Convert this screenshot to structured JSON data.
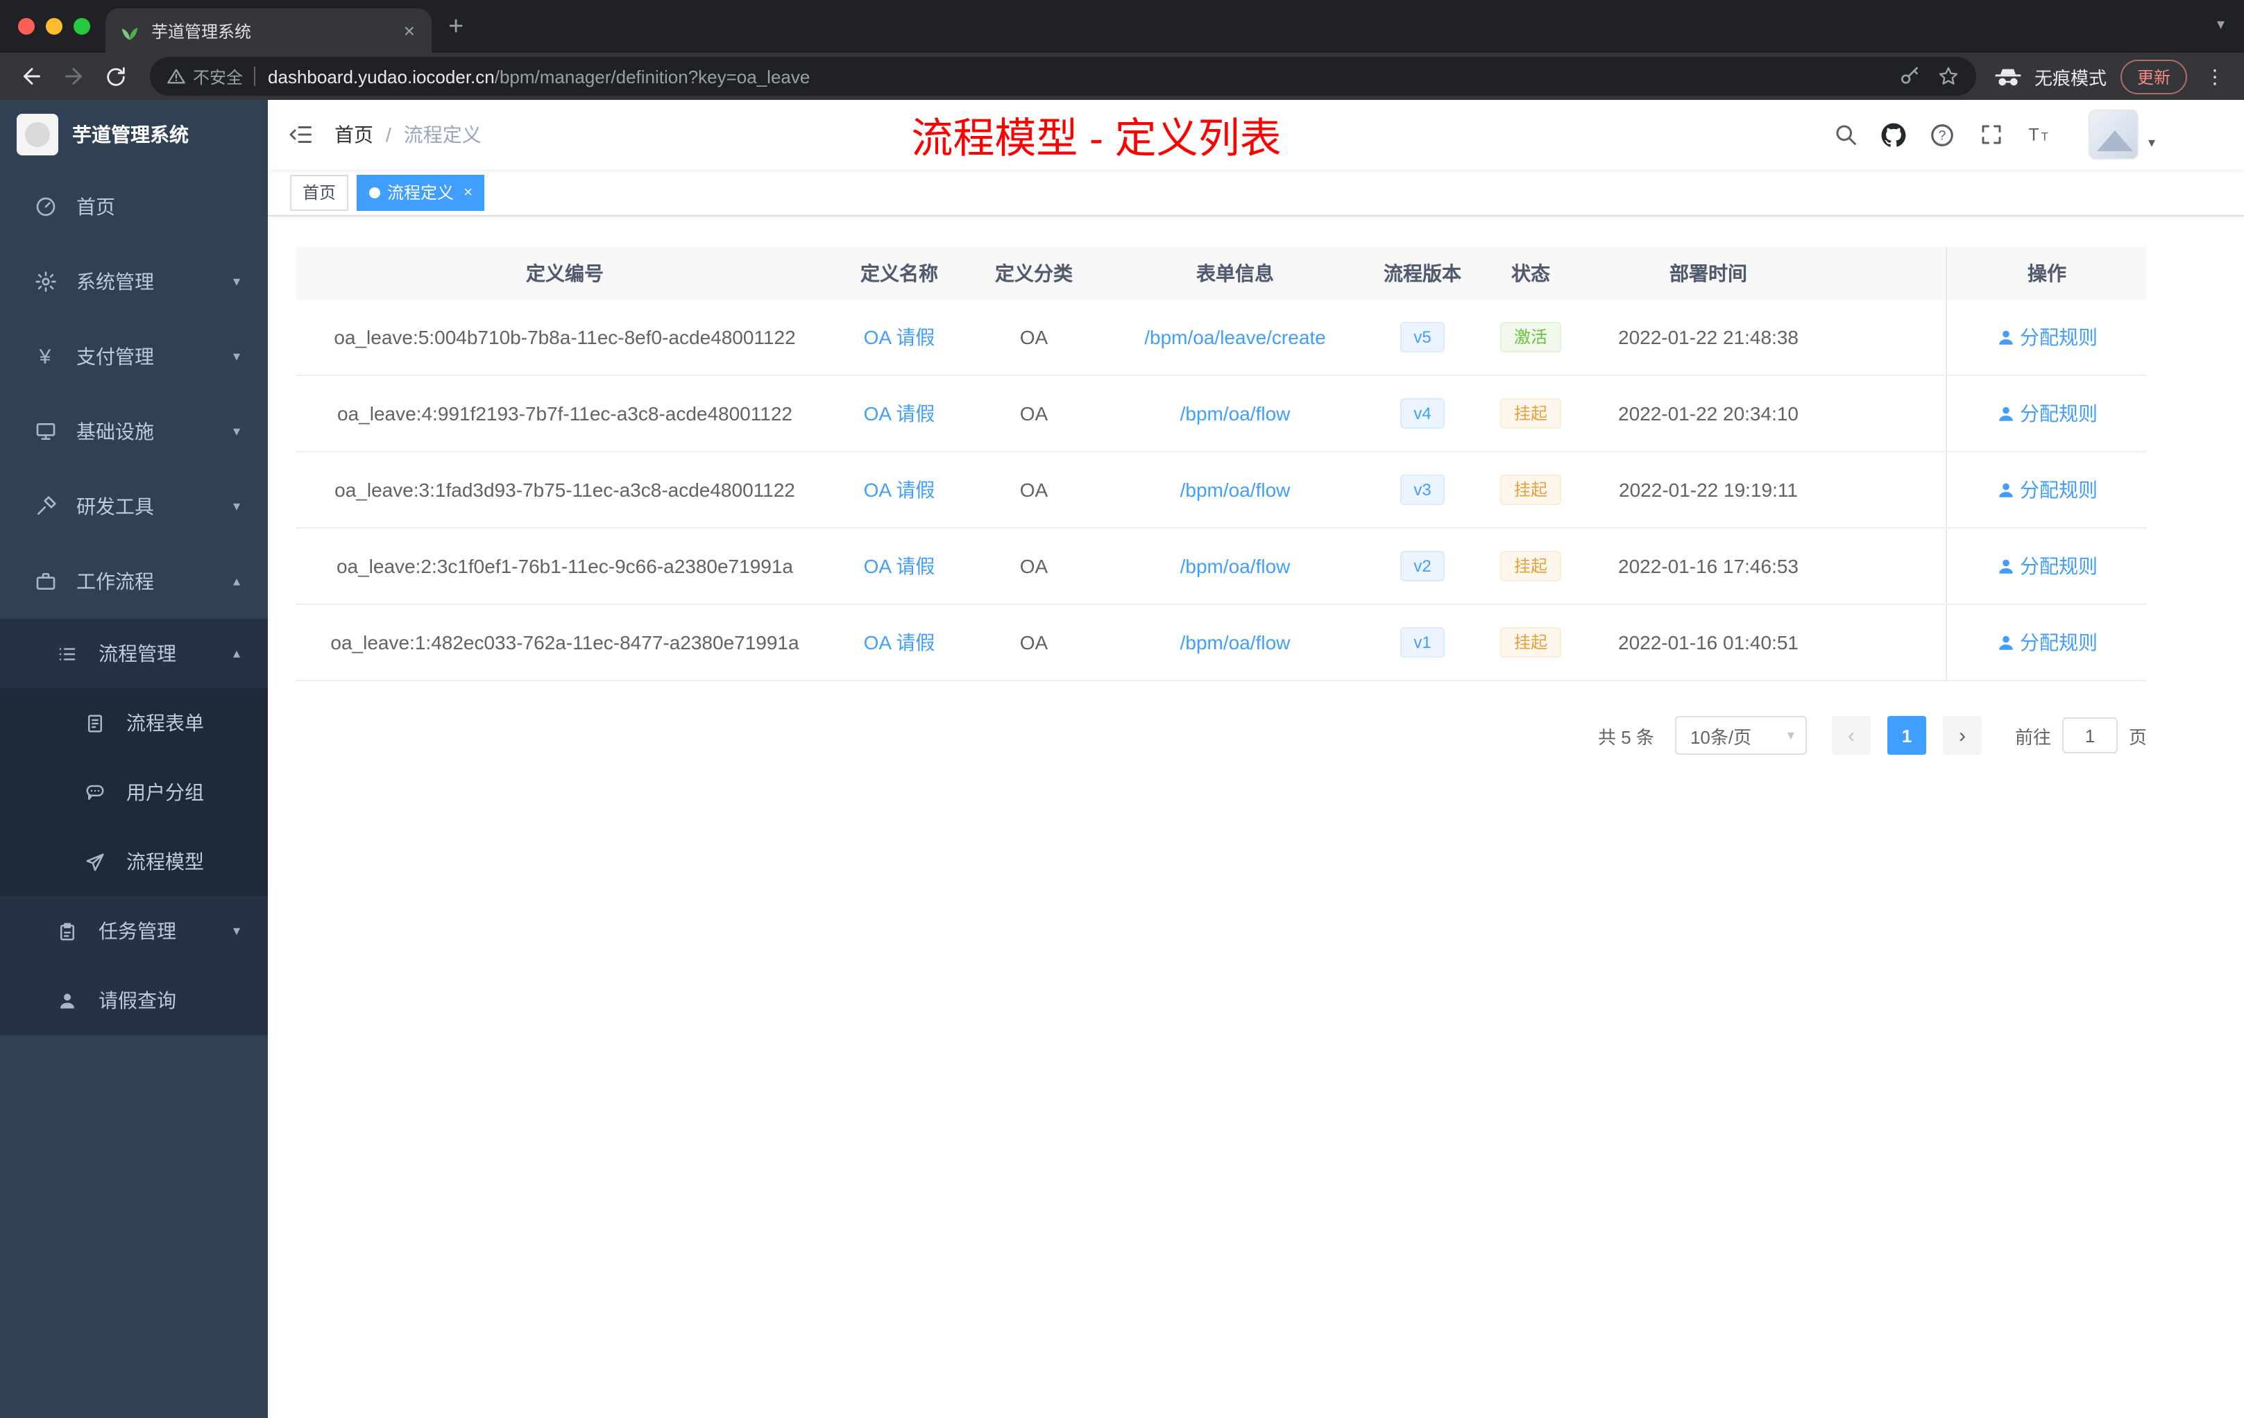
{
  "colors": {
    "accent": "#409eff",
    "success": "#67c23a",
    "warning": "#e6a23c",
    "annotation_red": "#ff0000",
    "sidebar_bg": "#304156"
  },
  "browser": {
    "tab_title": "芋道管理系统",
    "not_secure": "不安全",
    "url_host": "dashboard.yudao.iocoder.cn",
    "url_path": "/bpm/manager/definition?key=oa_leave",
    "incognito_label": "无痕模式",
    "update_label": "更新"
  },
  "sidebar": {
    "logo_title": "芋道管理系统",
    "items": [
      {
        "label": "首页"
      },
      {
        "label": "系统管理"
      },
      {
        "label": "支付管理"
      },
      {
        "label": "基础设施"
      },
      {
        "label": "研发工具"
      },
      {
        "label": "工作流程"
      },
      {
        "label": "流程管理"
      },
      {
        "label": "流程表单"
      },
      {
        "label": "用户分组"
      },
      {
        "label": "流程模型"
      },
      {
        "label": "任务管理"
      },
      {
        "label": "请假查询"
      }
    ]
  },
  "navbar": {
    "breadcrumb_home": "首页",
    "breadcrumb_separator": "/",
    "breadcrumb_current": "流程定义",
    "annotation": "流程模型 - 定义列表"
  },
  "tags": {
    "home": "首页",
    "active": "流程定义"
  },
  "table": {
    "columns": [
      "定义编号",
      "定义名称",
      "定义分类",
      "表单信息",
      "流程版本",
      "状态",
      "部署时间",
      "操作"
    ],
    "rows": [
      {
        "id": "oa_leave:5:004b710b-7b8a-11ec-8ef0-acde48001122",
        "name": "OA 请假",
        "category": "OA",
        "form": "/bpm/oa/leave/create",
        "version": "v5",
        "status": "激活",
        "status_class": "tag-success",
        "time": "2022-01-22 21:48:38",
        "action": "分配规则"
      },
      {
        "id": "oa_leave:4:991f2193-7b7f-11ec-a3c8-acde48001122",
        "name": "OA 请假",
        "category": "OA",
        "form": "/bpm/oa/flow",
        "version": "v4",
        "status": "挂起",
        "status_class": "tag-warning",
        "time": "2022-01-22 20:34:10",
        "action": "分配规则"
      },
      {
        "id": "oa_leave:3:1fad3d93-7b75-11ec-a3c8-acde48001122",
        "name": "OA 请假",
        "category": "OA",
        "form": "/bpm/oa/flow",
        "version": "v3",
        "status": "挂起",
        "status_class": "tag-warning",
        "time": "2022-01-22 19:19:11",
        "action": "分配规则"
      },
      {
        "id": "oa_leave:2:3c1f0ef1-76b1-11ec-9c66-a2380e71991a",
        "name": "OA 请假",
        "category": "OA",
        "form": "/bpm/oa/flow",
        "version": "v2",
        "status": "挂起",
        "status_class": "tag-warning",
        "time": "2022-01-16 17:46:53",
        "action": "分配规则"
      },
      {
        "id": "oa_leave:1:482ec033-762a-11ec-8477-a2380e71991a",
        "name": "OA 请假",
        "category": "OA",
        "form": "/bpm/oa/flow",
        "version": "v1",
        "status": "挂起",
        "status_class": "tag-warning",
        "time": "2022-01-16 01:40:51",
        "action": "分配规则"
      }
    ]
  },
  "pagination": {
    "total": "共 5 条",
    "page_size": "10条/页",
    "current_page": "1",
    "goto_label": "前往",
    "goto_value": "1",
    "page_unit": "页"
  }
}
